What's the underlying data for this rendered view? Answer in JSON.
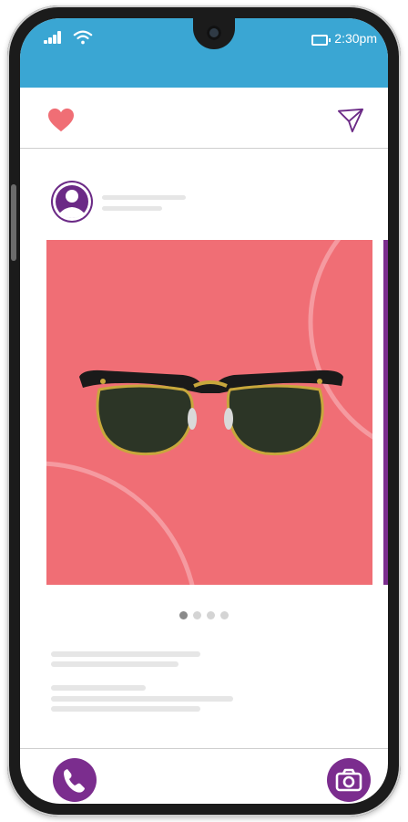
{
  "status_bar": {
    "time": "2:30pm",
    "icons": [
      "signal-icon",
      "wifi-icon",
      "battery-icon"
    ],
    "background": "#3aa6d3"
  },
  "header": {
    "left_icon": "heart-icon",
    "right_icon": "send-icon",
    "heart_color": "#f06e75",
    "send_color": "#6b2a86"
  },
  "post": {
    "avatar_icon": "user-avatar-icon",
    "image_subject": "sunglasses",
    "image_background": "#f06e75",
    "next_card_color": "#7b2d8e",
    "carousel": {
      "total": 4,
      "active": 1
    }
  },
  "bottom_bar": {
    "left_icon": "phone-icon",
    "right_icon": "camera-icon",
    "accent": "#7b2d8e"
  }
}
